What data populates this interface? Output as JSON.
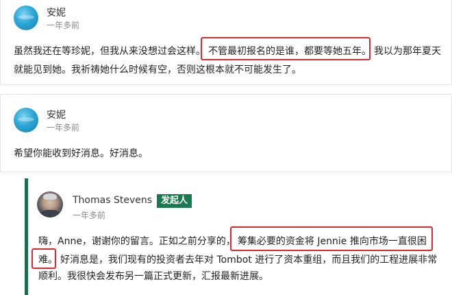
{
  "comments": [
    {
      "author": "安妮",
      "time": "一年多前",
      "lines": [
        {
          "pre": "虽然我还在等珍妮，但我从来没想过会这样。",
          "hl": "不管最初报名的是谁，都要等她五年。",
          "post": "我以为那年夏天"
        },
        {
          "text": "就能见到她。我祈祷她什么时候有空，否则这根本就不可能发生了。"
        }
      ]
    },
    {
      "author": "安妮",
      "time": "一年多前",
      "lines": [
        {
          "text": "希望你能收到好消息。好消息。"
        }
      ]
    },
    {
      "author": "Thomas Stevens",
      "badge": "发起人",
      "time": "一年多前",
      "lines": [
        {
          "pre": "嗨，Anne，谢谢你的留言。正如之前分享的，",
          "hl": "筹集必要的资金将 Jennie 推向市场一直很困"
        },
        {
          "hl": "难。",
          "post": "好消息是，我们现有的投资者去年对 Tombot 进行了资本重组，而且我们的工程进展非常"
        },
        {
          "text": "顺利。我很快会发布另一篇正式更新，汇报最新进展。"
        }
      ]
    }
  ],
  "colors": {
    "accent_bar": "#1f6b4f",
    "badge_bg": "#1a7a4f",
    "highlight": "#e0262d"
  }
}
